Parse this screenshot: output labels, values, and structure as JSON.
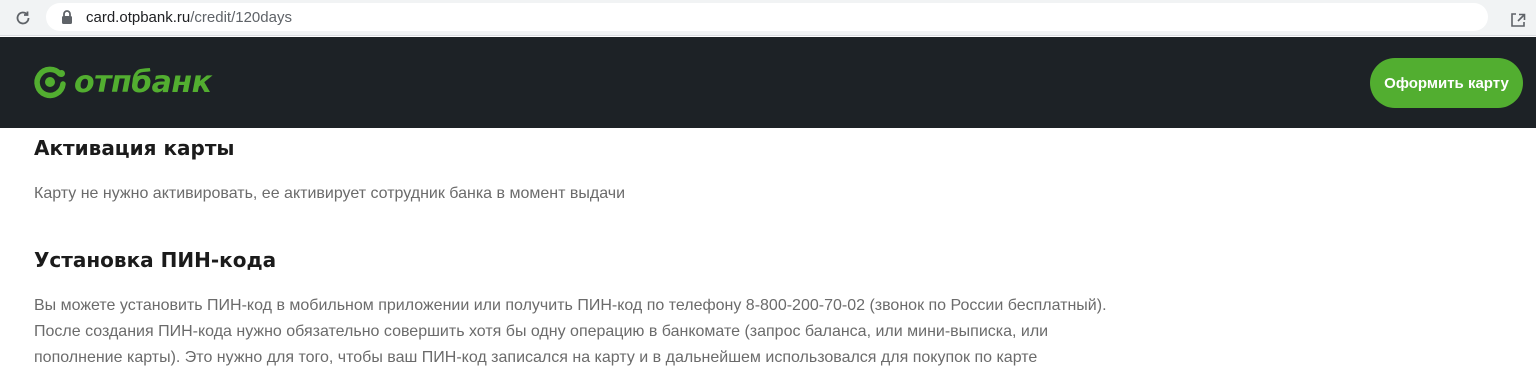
{
  "browser": {
    "url_host": "card.otpbank.ru",
    "url_path": "/credit/120days",
    "icons": [
      "reload-icon",
      "lock-icon",
      "share-icon",
      "star-icon"
    ]
  },
  "header": {
    "logo_text": "отпбанк",
    "cta_label": "Оформить карту",
    "colors": {
      "background": "#1d2226",
      "brand_green": "#52ae30"
    }
  },
  "sections": [
    {
      "heading": "Активация карты",
      "lines": [
        "Карту не нужно активировать, ее активирует сотрудник банка в момент выдачи"
      ]
    },
    {
      "heading": "Установка ПИН-кода",
      "lines": [
        "Вы можете установить ПИН-код в мобильном приложении или получить ПИН-код по телефону 8-800-200-70-02 (звонок по России бесплатный).",
        "После создания ПИН-кода нужно обязательно совершить хотя бы одну операцию в банкомате (запрос баланса, или мини-выписка, или",
        "пополнение карты). Это нужно для того, чтобы ваш ПИН-код записался на карту и в дальнейшем использовался для покупок по карте"
      ]
    }
  ]
}
